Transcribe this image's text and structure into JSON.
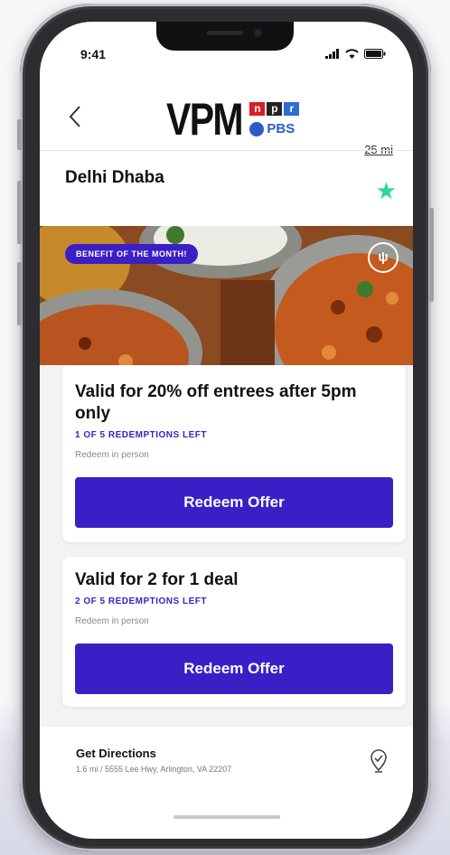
{
  "status_bar": {
    "time": "9:41"
  },
  "header": {
    "back_icon": "chevron-left-icon",
    "brand_main": "VPM",
    "npr_letters": [
      "n",
      "p",
      "r"
    ],
    "pbs_label": "PBS",
    "distance": "25 mi"
  },
  "restaurant": {
    "name": "Delhi Dhaba",
    "favorite_icon": "star-icon",
    "favorite_color": "#2fd3a3"
  },
  "hero": {
    "badge": "BENEFIT OF THE MONTH!",
    "category_icon": "utensils-icon"
  },
  "offers": [
    {
      "title": "Valid for 20% off entrees after 5pm only",
      "redemptions": "1 OF 5 REDEMPTIONS LEFT",
      "note": "Redeem in person",
      "button": "Redeem Offer"
    },
    {
      "title": "Valid for 2 for 1 deal",
      "redemptions": "2 OF 5 REDEMPTIONS LEFT",
      "note": "Redeem in person",
      "button": "Redeem Offer"
    }
  ],
  "directions": {
    "title": "Get Directions",
    "address": "1.6 mi / 5555 Lee Hwy, Arlington, VA 22207",
    "icon": "map-pin-icon"
  },
  "colors": {
    "accent": "#3a1fc6",
    "npr_red": "#d62021",
    "npr_blue": "#2e6cd0",
    "pbs_blue": "#2b5bc7"
  }
}
